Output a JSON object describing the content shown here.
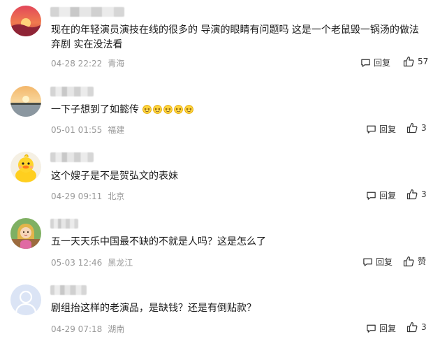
{
  "comments": [
    {
      "text": "现在的年轻演员演技在线的很多的 导演的眼睛有问题吗 这是一个老鼠毁一锅汤的做法 弃剧 实在没法看",
      "date": "04-28 22:22",
      "location": "青海",
      "reply_label": "回复",
      "like_label": "57",
      "avatar_icon": "sunset-avatar-icon"
    },
    {
      "text": "一下子想到了如懿传",
      "emoji_count": 5,
      "emoji_icon": "squint-face-emoji-icon",
      "date": "05-01 01:55",
      "location": "福建",
      "reply_label": "回复",
      "like_label": "3",
      "avatar_icon": "lake-sunset-avatar-icon"
    },
    {
      "text": "这个嫂子是不是贺弘文的表妹",
      "date": "04-29 09:11",
      "location": "北京",
      "reply_label": "回复",
      "like_label": "3",
      "avatar_icon": "yellow-duck-avatar-icon"
    },
    {
      "text": "五一天天乐中国最不缺的不就是人吗？这是怎么了",
      "date": "05-03 12:46",
      "location": "黑龙江",
      "reply_label": "回复",
      "like_label": "赞",
      "avatar_icon": "cartoon-girl-avatar-icon"
    },
    {
      "text": "剧组抬这样的老演品，是缺钱？还是有倒贴款？",
      "date": "04-29 07:18",
      "location": "湖南",
      "reply_label": "回复",
      "like_label": "3",
      "avatar_icon": "default-user-avatar-icon"
    }
  ],
  "colors": {
    "meta_text": "#999999",
    "body_text": "#1a1a1a",
    "action_text": "#333333",
    "avatar_default_bg": "#dbe4f5"
  }
}
